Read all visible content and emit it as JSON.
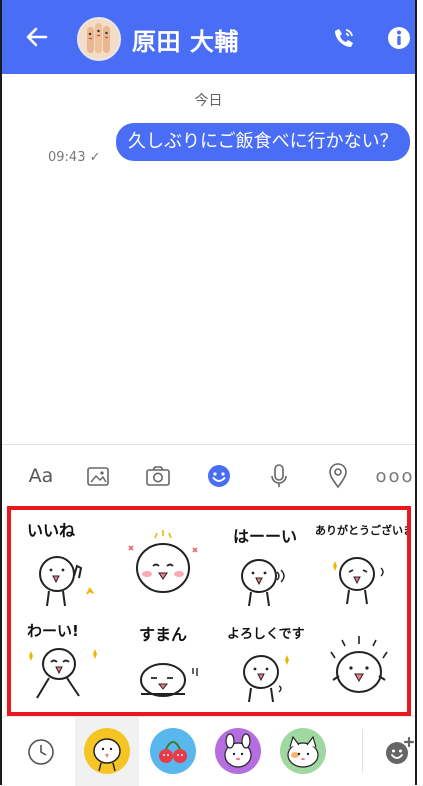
{
  "header": {
    "contact_name": "原田 大輔",
    "icons": [
      "back-arrow-icon",
      "avatar",
      "phone-call-icon",
      "info-icon"
    ]
  },
  "chat": {
    "date_separator": "今日",
    "messages": [
      {
        "text": "久しぶりにご飯食べに行かない？",
        "time": "09:43 ✓",
        "outgoing": true
      }
    ]
  },
  "toolbar": {
    "text_label": "Aa",
    "items": [
      "text-format",
      "image-icon",
      "camera-icon",
      "sticker-icon",
      "microphone-icon",
      "location-icon",
      "more-icon"
    ],
    "more_label": "ooo"
  },
  "stickers": {
    "items": [
      {
        "caption": "いいね"
      },
      {
        "caption": ""
      },
      {
        "caption": "はーーい"
      },
      {
        "caption": "ありがとうございます"
      },
      {
        "caption": "わーい!"
      },
      {
        "caption": "すまん"
      },
      {
        "caption": "よろしくです"
      },
      {
        "caption": ""
      }
    ]
  },
  "bottom_bar": {
    "items": [
      "recent-icon",
      "sticker-pack-1",
      "sticker-pack-2",
      "sticker-pack-3",
      "sticker-pack-4",
      "add-sticker-icon"
    ]
  },
  "colors": {
    "accent": "#4a6df5",
    "highlight_border": "#e8181f"
  }
}
